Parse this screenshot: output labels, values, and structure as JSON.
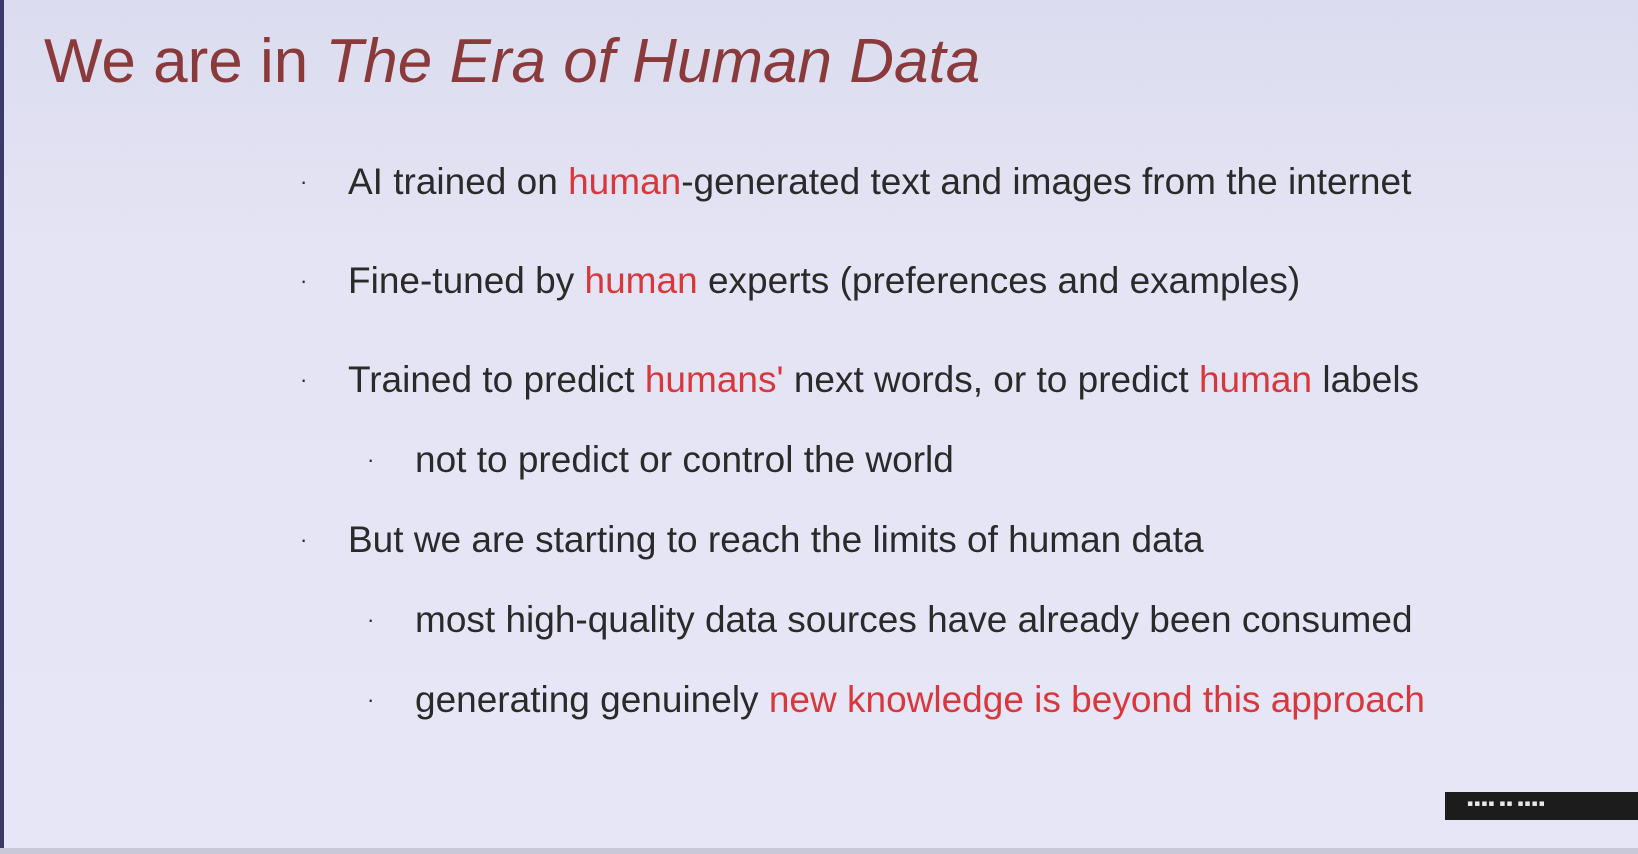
{
  "slide": {
    "title_plain": "We are in ",
    "title_italic": "The Era of Human Data",
    "bullets": [
      {
        "segments": [
          {
            "text": "AI trained on ",
            "highlight": false
          },
          {
            "text": "human",
            "highlight": true
          },
          {
            "text": "-generated text and images from the internet",
            "highlight": false
          }
        ]
      },
      {
        "segments": [
          {
            "text": "Fine-tuned by ",
            "highlight": false
          },
          {
            "text": "human",
            "highlight": true
          },
          {
            "text": " experts (preferences and examples)",
            "highlight": false
          }
        ]
      },
      {
        "segments": [
          {
            "text": "Trained to predict ",
            "highlight": false
          },
          {
            "text": "humans'",
            "highlight": true
          },
          {
            "text": " next words, or to predict ",
            "highlight": false
          },
          {
            "text": "human",
            "highlight": true
          },
          {
            "text": " labels",
            "highlight": false
          }
        ],
        "sub": [
          {
            "segments": [
              {
                "text": "not to predict or control the world",
                "highlight": false
              }
            ]
          }
        ]
      },
      {
        "segments": [
          {
            "text": "But we are starting to reach the limits of human data",
            "highlight": false
          }
        ],
        "sub": [
          {
            "segments": [
              {
                "text": "most high-quality data sources have already been consumed",
                "highlight": false
              }
            ]
          },
          {
            "segments": [
              {
                "text": "generating genuinely ",
                "highlight": false
              },
              {
                "text": "new knowledge is beyond this approach",
                "highlight": true
              }
            ]
          }
        ]
      }
    ],
    "bullet_glyph": "·",
    "colors": {
      "title": "#8a3a3a",
      "text": "#2a2a2a",
      "highlight": "#d8383c",
      "background": "#e4e4f4"
    }
  }
}
